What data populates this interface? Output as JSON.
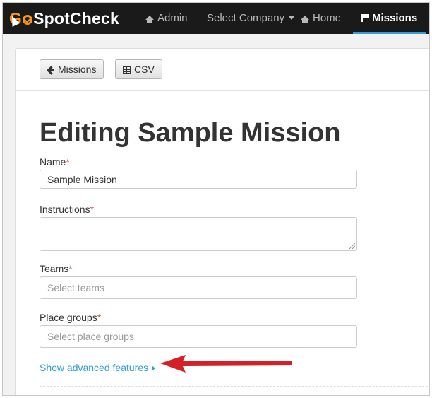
{
  "app": {
    "logo_text": "GoSpotCheck"
  },
  "navbar": {
    "items": [
      {
        "label": "Admin",
        "icon": "home-icon"
      },
      {
        "label": "Select Company",
        "icon": "chevron-down-icon"
      },
      {
        "label": "Home",
        "icon": "home-icon"
      },
      {
        "label": "Missions",
        "icon": "flag-icon",
        "active": true
      }
    ],
    "accent_color": "#2f9fd7",
    "background": "#1a1a1a"
  },
  "toolbar": {
    "missions_label": "Missions",
    "csv_label": "CSV"
  },
  "page": {
    "title": "Editing Sample Mission"
  },
  "form": {
    "name": {
      "label": "Name",
      "required_mark": "*",
      "value": "Sample Mission"
    },
    "instructions": {
      "label": "Instructions",
      "required_mark": "*",
      "value": ""
    },
    "teams": {
      "label": "Teams",
      "required_mark": "*",
      "placeholder": "Select teams"
    },
    "place_groups": {
      "label": "Place groups",
      "required_mark": "*",
      "placeholder": "Select place groups"
    },
    "advanced_link": "Show advanced features"
  },
  "annotation": {
    "arrow_color": "#d42027"
  }
}
